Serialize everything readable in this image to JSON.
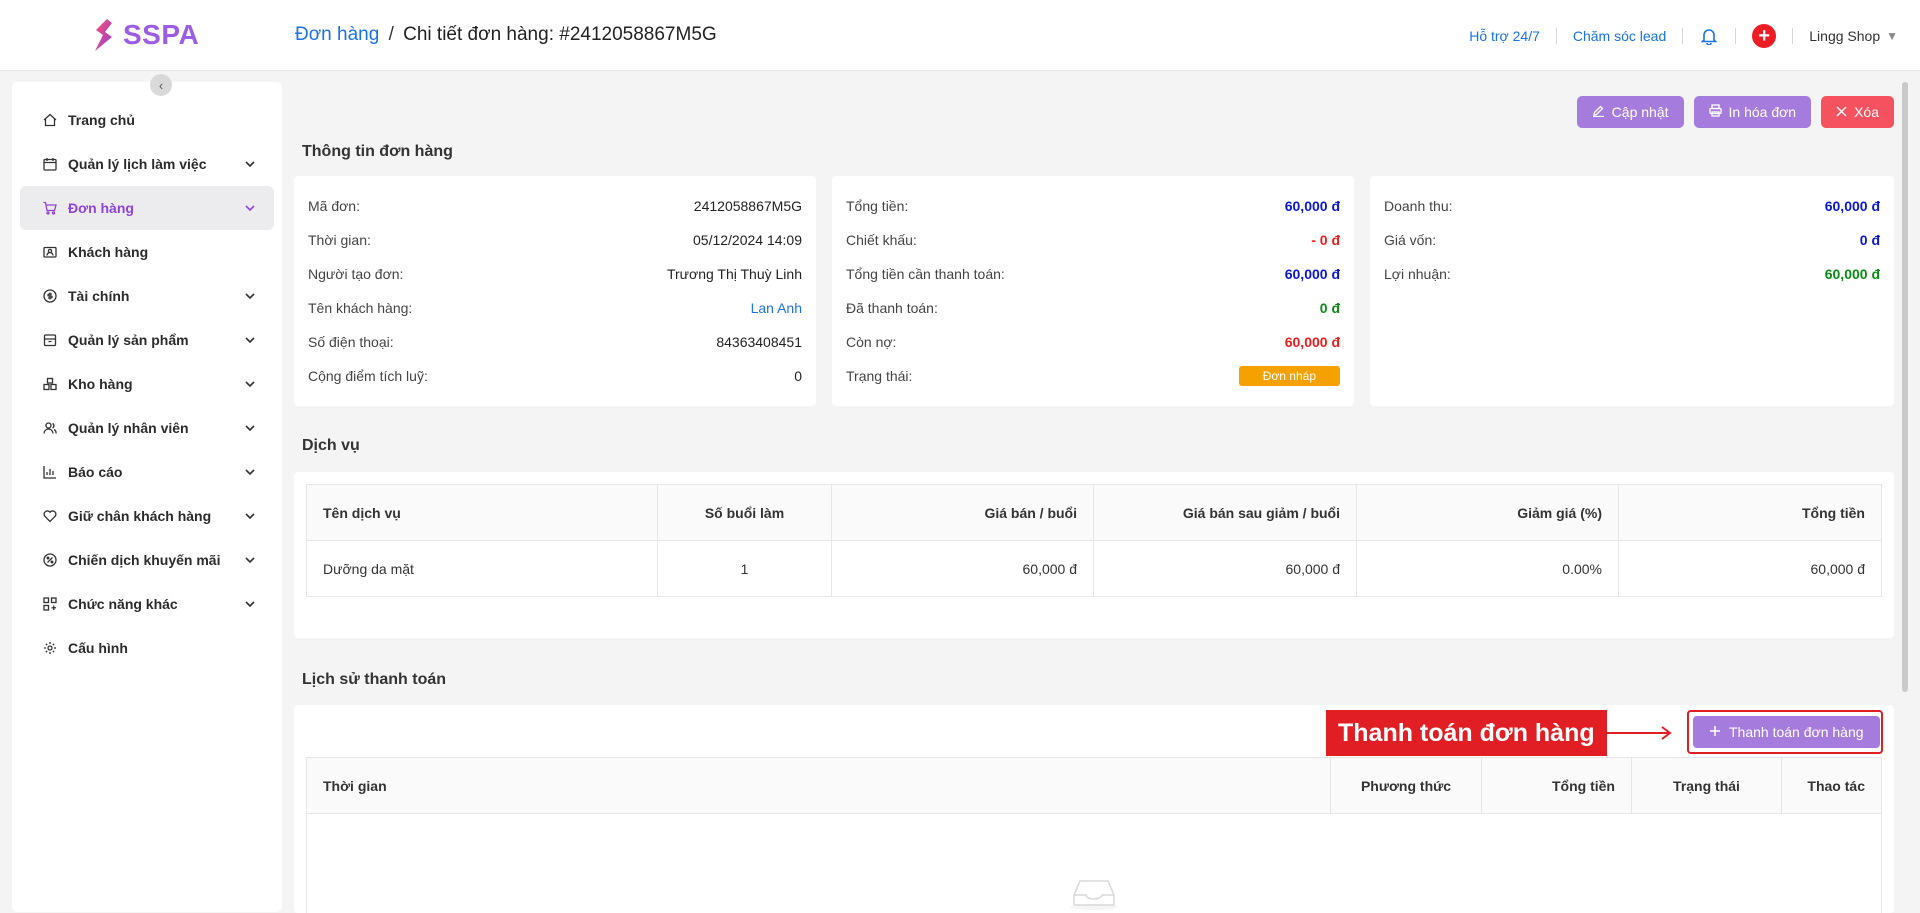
{
  "brand": {
    "name": "SSPA",
    "color": "#9b5de5"
  },
  "breadcrumb": {
    "parent": "Đơn hàng",
    "separator": "/",
    "current": "Chi tiết đơn hàng: #2412058867M5G"
  },
  "header": {
    "support": "Hỗ trợ 24/7",
    "lead_care": "Chăm sóc lead",
    "bell_icon": "bell-icon",
    "add_icon": "plus-circle-icon",
    "shop_name": "Lingg Shop"
  },
  "sidebar": {
    "collapse_icon": "chevron-left-icon",
    "items": [
      {
        "label": "Trang chủ",
        "icon": "home-icon",
        "has_chevron": false,
        "active": false
      },
      {
        "label": "Quản lý lịch làm việc",
        "icon": "calendar-icon",
        "has_chevron": true,
        "active": false
      },
      {
        "label": "Đơn hàng",
        "icon": "cart-icon",
        "has_chevron": true,
        "active": true
      },
      {
        "label": "Khách hàng",
        "icon": "id-card-icon",
        "has_chevron": false,
        "active": false
      },
      {
        "label": "Tài chính",
        "icon": "dollar-circle-icon",
        "has_chevron": true,
        "active": false
      },
      {
        "label": "Quản lý sản phẩm",
        "icon": "box-icon",
        "has_chevron": true,
        "active": false
      },
      {
        "label": "Kho hàng",
        "icon": "warehouse-icon",
        "has_chevron": true,
        "active": false
      },
      {
        "label": "Quản lý nhân viên",
        "icon": "users-icon",
        "has_chevron": true,
        "active": false
      },
      {
        "label": "Báo cáo",
        "icon": "bar-chart-icon",
        "has_chevron": true,
        "active": false
      },
      {
        "label": "Giữ chân khách hàng",
        "icon": "heart-icon",
        "has_chevron": true,
        "active": false
      },
      {
        "label": "Chiến dịch khuyến mãi",
        "icon": "percent-icon",
        "has_chevron": true,
        "active": false
      },
      {
        "label": "Chức năng khác",
        "icon": "grid-icon",
        "has_chevron": true,
        "active": false
      },
      {
        "label": "Cấu hình",
        "icon": "gear-icon",
        "has_chevron": false,
        "active": false
      }
    ]
  },
  "actions": {
    "update": "Cập nhật",
    "print": "In hóa đơn",
    "delete": "Xóa"
  },
  "order_info": {
    "title": "Thông tin đơn hàng",
    "col1": [
      {
        "label": "Mã đơn:",
        "value": "2412058867M5G"
      },
      {
        "label": "Thời gian:",
        "value": "05/12/2024 14:09"
      },
      {
        "label": "Người tạo đơn:",
        "value": "Trương Thị Thuỳ Linh"
      },
      {
        "label": "Tên khách hàng:",
        "value": "Lan Anh"
      },
      {
        "label": "Số điện thoại:",
        "value": "84363408451"
      },
      {
        "label": "Cộng điểm tích luỹ:",
        "value": "0"
      }
    ],
    "col2": [
      {
        "label": "Tổng tiền:",
        "value": "60,000 đ"
      },
      {
        "label": "Chiết khấu:",
        "value": "- 0 đ"
      },
      {
        "label": "Tổng tiền cần thanh toán:",
        "value": "60,000 đ"
      },
      {
        "label": "Đã thanh toán:",
        "value": "0 đ"
      },
      {
        "label": "Còn nợ:",
        "value": "60,000 đ"
      },
      {
        "label": "Trạng thái:",
        "value": "Đơn nháp"
      }
    ],
    "col3": [
      {
        "label": "Doanh thu:",
        "value": "60,000 đ"
      },
      {
        "label": "Giá vốn:",
        "value": "0 đ"
      },
      {
        "label": "Lợi nhuận:",
        "value": "60,000 đ"
      }
    ]
  },
  "services": {
    "title": "Dịch vụ",
    "headers": [
      "Tên dịch vụ",
      "Số buổi làm",
      "Giá bán / buổi",
      "Giá bán sau giảm / buổi",
      "Giảm giá (%)",
      "Tổng tiền"
    ],
    "rows": [
      [
        "Dưỡng da mặt",
        "1",
        "60,000 đ",
        "60,000 đ",
        "0.00%",
        "60,000 đ"
      ]
    ]
  },
  "payment_history": {
    "title": "Lịch sử thanh toán",
    "pay_button": "Thanh toán đơn hàng",
    "callout": "Thanh toán đơn hàng",
    "headers": [
      "Thời gian",
      "Phương thức",
      "Tổng tiền",
      "Trạng thái",
      "Thao tác"
    ],
    "empty_icon": "empty-inbox-icon"
  },
  "colors": {
    "accent": "#a57cdd",
    "danger": "#f5515f",
    "callout": "#e01e23",
    "status_draft": "#f5a100"
  }
}
